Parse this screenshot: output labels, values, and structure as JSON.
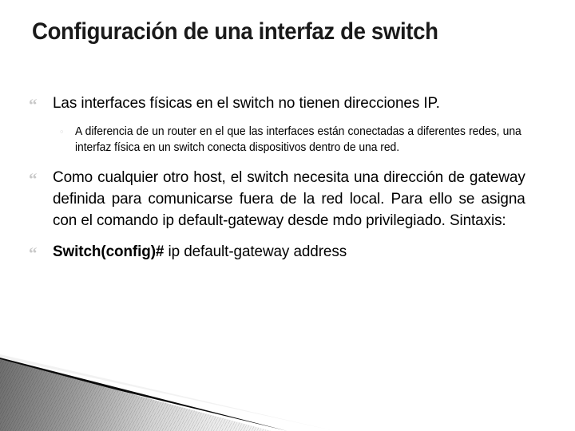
{
  "slide": {
    "title": "Configuración de una interfaz de switch",
    "bullets": [
      {
        "level": 1,
        "marker": "double-quote-marker",
        "marker_glyph": "“",
        "text": "Las interfaces físicas en el switch no tienen direcciones IP."
      },
      {
        "level": 2,
        "marker": "hollow-circle-marker",
        "marker_glyph": "◦",
        "text": "A diferencia de un router en el que las interfaces están conectadas a diferentes redes, una interfaz física en un switch conecta dispositivos dentro de una red."
      },
      {
        "level": 1,
        "marker": "double-quote-marker",
        "marker_glyph": "“",
        "text": "Como cualquier otro host, el switch necesita una dirección de gateway definida para comunicarse fuera de la red local. Para ello se asigna con el comando ip default-gateway desde mdo privilegiado.  Sintaxis:"
      },
      {
        "level": 1,
        "marker": "double-quote-marker",
        "marker_glyph": "“",
        "command_bold": "Switch(config)#",
        "command_rest": " ip default-gateway address"
      }
    ]
  },
  "theme": {
    "background": "#ffffff",
    "text_color": "#000000",
    "title_color": "#1a1a1a",
    "marker_color": "#c9c9c9",
    "accent_dark": "#0a0a0a",
    "accent_gray": "#9a9a9a"
  }
}
